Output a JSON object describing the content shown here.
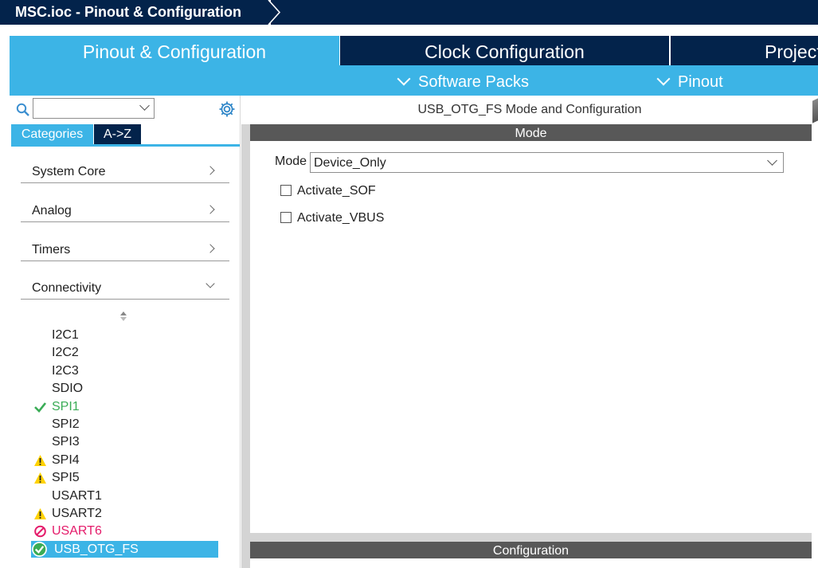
{
  "titlebar": {
    "title": "MSC.ioc - Pinout & Configuration"
  },
  "tabs": [
    {
      "label": "Pinout & Configuration",
      "active": true
    },
    {
      "label": "Clock Configuration",
      "active": false
    },
    {
      "label": "Project",
      "active": false
    }
  ],
  "subbar": {
    "software_packs": "Software Packs",
    "pinout": "Pinout"
  },
  "left": {
    "search": {
      "value": ""
    },
    "category_tabs": [
      "Categories",
      "A->Z"
    ],
    "groups": [
      {
        "label": "System Core",
        "expanded": false
      },
      {
        "label": "Analog",
        "expanded": false
      },
      {
        "label": "Timers",
        "expanded": false
      },
      {
        "label": "Connectivity",
        "expanded": true
      }
    ],
    "peripherals": [
      {
        "label": "I2C1",
        "status": "none"
      },
      {
        "label": "I2C2",
        "status": "none"
      },
      {
        "label": "I2C3",
        "status": "none"
      },
      {
        "label": "SDIO",
        "status": "none"
      },
      {
        "label": "SPI1",
        "status": "ok"
      },
      {
        "label": "SPI2",
        "status": "none"
      },
      {
        "label": "SPI3",
        "status": "none"
      },
      {
        "label": "SPI4",
        "status": "warning"
      },
      {
        "label": "SPI5",
        "status": "warning"
      },
      {
        "label": "USART1",
        "status": "none"
      },
      {
        "label": "USART2",
        "status": "warning"
      },
      {
        "label": "USART6",
        "status": "error"
      },
      {
        "label": "USB_OTG_FS",
        "status": "selected"
      }
    ]
  },
  "right": {
    "title": "USB_OTG_FS Mode and Configuration",
    "mode_section": "Mode",
    "mode_label": "Mode",
    "mode_value": "Device_Only",
    "checkboxes": [
      {
        "label": "Activate_SOF",
        "checked": false
      },
      {
        "label": "Activate_VBUS",
        "checked": false
      }
    ],
    "config_section": "Configuration"
  },
  "colors": {
    "navy": "#03234b",
    "accent": "#3cb4e6",
    "ok": "#3aac56",
    "warning": "#ffd200",
    "error": "#e41b6a"
  }
}
